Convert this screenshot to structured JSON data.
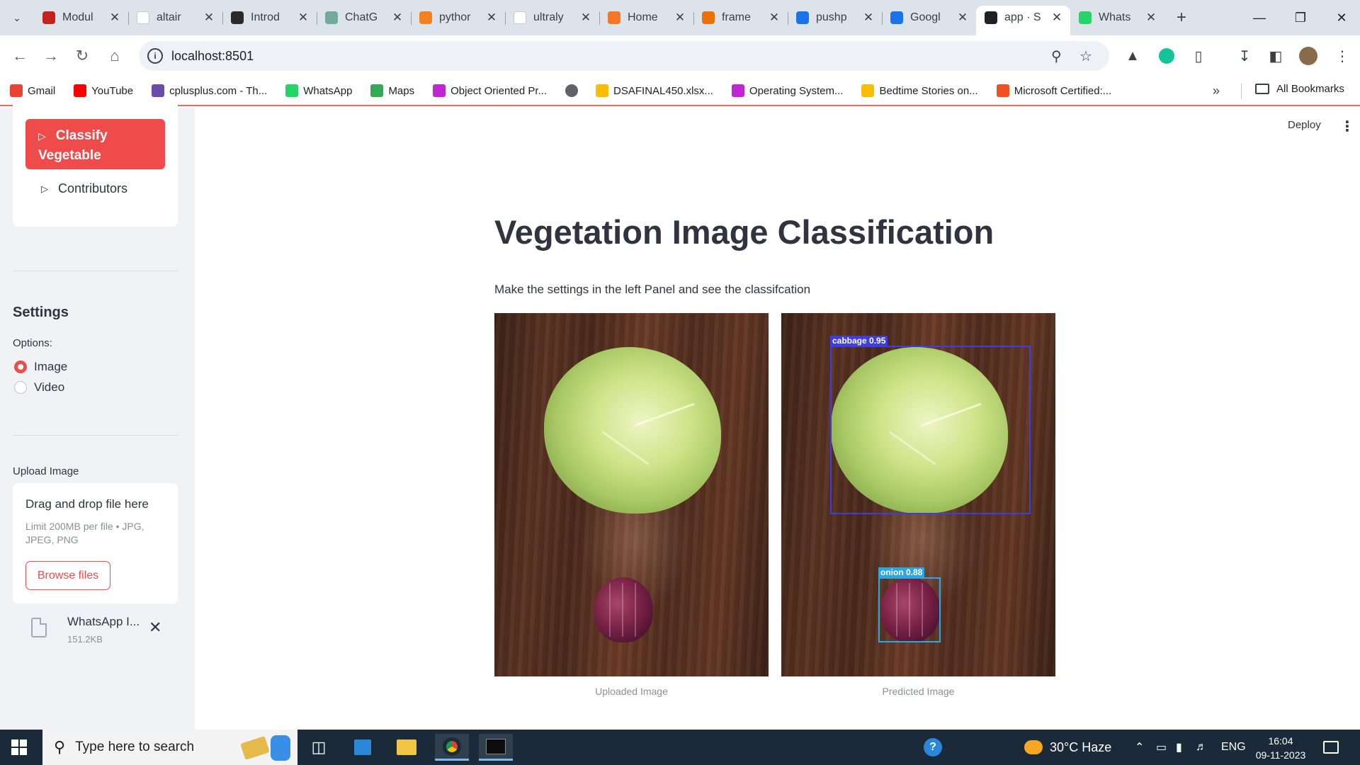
{
  "browser": {
    "tabs": [
      {
        "label": "Modul",
        "icon": "gmail-icon",
        "color": "#c5221f"
      },
      {
        "label": "altair",
        "icon": "page-icon",
        "color": "#ffffff"
      },
      {
        "label": "Introd",
        "icon": "openai-icon",
        "color": "#2a2a2a"
      },
      {
        "label": "ChatG",
        "icon": "chatgpt-icon",
        "color": "#74aa9c"
      },
      {
        "label": "pythor",
        "icon": "stackoverflow-icon",
        "color": "#f48024"
      },
      {
        "label": "ultraly",
        "icon": "page-icon",
        "color": "#ffffff"
      },
      {
        "label": "Home",
        "icon": "jupyter-icon",
        "color": "#f37726"
      },
      {
        "label": "frame",
        "icon": "notebook-icon",
        "color": "#e8710a"
      },
      {
        "label": "pushp",
        "icon": "drive-icon",
        "color": "#1a73e8"
      },
      {
        "label": "Googl",
        "icon": "drive-icon",
        "color": "#1a73e8"
      },
      {
        "label": "app · S",
        "icon": "streamlit-icon",
        "color": "#202124"
      },
      {
        "label": "Whats",
        "icon": "whatsapp-icon",
        "color": "#25d366"
      }
    ],
    "url": "localhost:8501",
    "bookmarks": [
      {
        "label": "Gmail",
        "icon": "gmail-icon",
        "color": "#ea4335"
      },
      {
        "label": "YouTube",
        "icon": "youtube-icon",
        "color": "#ff0000"
      },
      {
        "label": "cplusplus.com - Th...",
        "icon": "cplusplus-icon",
        "color": "#6a4cab"
      },
      {
        "label": "WhatsApp",
        "icon": "whatsapp-icon",
        "color": "#25d366"
      },
      {
        "label": "Maps",
        "icon": "maps-icon",
        "color": "#34a853"
      },
      {
        "label": "Object Oriented Pr...",
        "icon": "coding-ninjas-icon",
        "color": "#c026d3"
      },
      {
        "label": "",
        "icon": "globe-icon",
        "color": "#5f6368"
      },
      {
        "label": "DSAFINAL450.xlsx...",
        "icon": "drive-icon",
        "color": "#fbbc04"
      },
      {
        "label": "Operating System...",
        "icon": "coding-ninjas-icon",
        "color": "#c026d3"
      },
      {
        "label": "Bedtime Stories on...",
        "icon": "drive-icon",
        "color": "#fbbc04"
      },
      {
        "label": "Microsoft Certified:...",
        "icon": "microsoft-icon",
        "color": "#f25022"
      }
    ],
    "bookmarks_all": "All Bookmarks"
  },
  "sidebar": {
    "classify_button": "Classify Vegetable",
    "contributors": "Contributors",
    "settings_title": "Settings",
    "options_label": "Options:",
    "radio_options": [
      "Image",
      "Video"
    ],
    "radio_selected": "Image",
    "upload_label": "Upload Image",
    "dropzone_title": "Drag and drop file here",
    "dropzone_limit": "Limit 200MB per file • JPG, JPEG, PNG",
    "browse_button": "Browse files",
    "file_name": "WhatsApp I...",
    "file_size": "151.2KB"
  },
  "main": {
    "deploy": "Deploy",
    "title": "Vegetation Image Classification",
    "subtitle": "Make the settings in the left Panel and see the classifcation",
    "uploaded_caption": "Uploaded Image",
    "predicted_caption": "Predicted Image",
    "detections": [
      {
        "label": "cabbage  0.95",
        "color": "#3d3de0"
      },
      {
        "label": "onion  0.88",
        "color": "#29a8e6"
      }
    ]
  },
  "taskbar": {
    "search_placeholder": "Type here to search",
    "weather": "30°C  Haze",
    "language": "ENG",
    "time": "16:04",
    "date": "09-11-2023"
  },
  "colors": {
    "accent": "#f04b4b",
    "sidebar_bg": "#f0f2f6",
    "text": "#31333f"
  }
}
